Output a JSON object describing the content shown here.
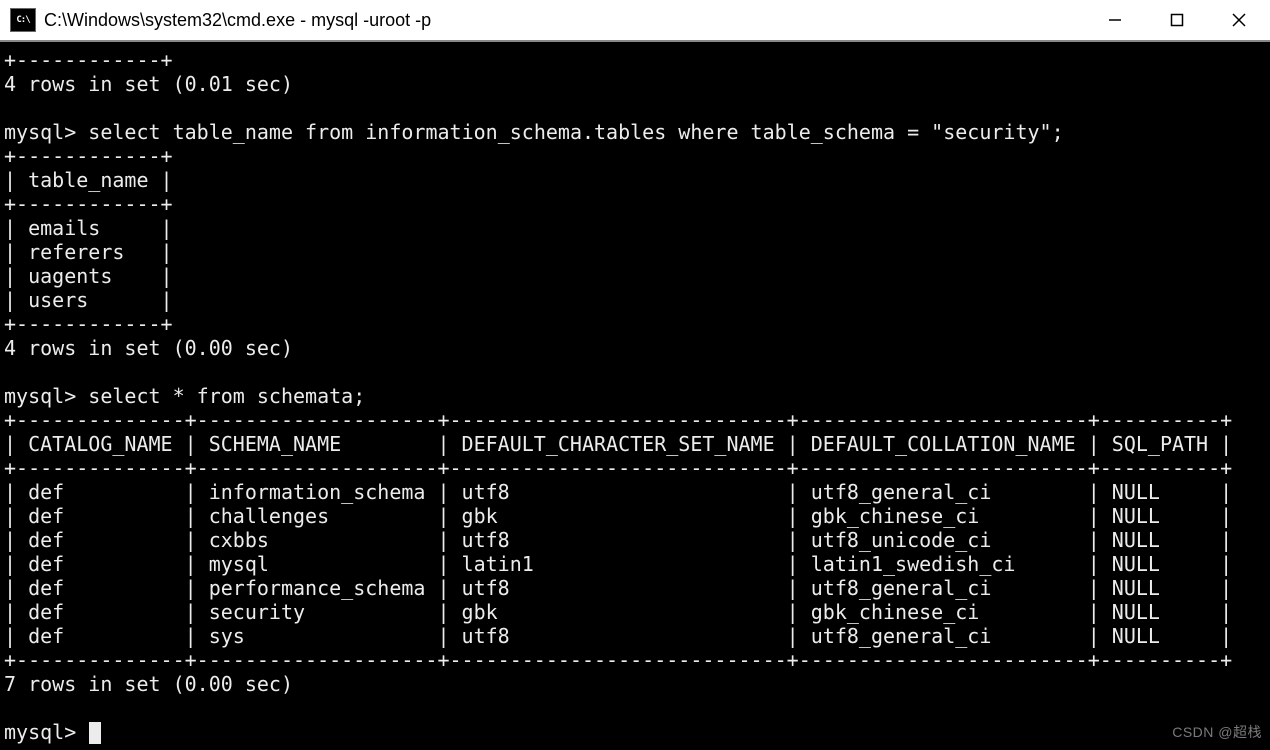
{
  "titlebar": {
    "icon_label": "C:\\",
    "title": "C:\\Windows\\system32\\cmd.exe - mysql  -uroot -p"
  },
  "terminal": {
    "top_border": "+------------+",
    "result1": "4 rows in set (0.01 sec)",
    "prompt": "mysql>",
    "query1": "select table_name from information_schema.tables where table_schema = \"security\";",
    "table1": {
      "border": "+------------+",
      "header_line": "| table_name |",
      "rows": [
        "| emails     |",
        "| referers   |",
        "| uagents    |",
        "| users      |"
      ]
    },
    "result2": "4 rows in set (0.00 sec)",
    "query2": "select * from schemata;",
    "table2": {
      "border": "+--------------+--------------------+----------------------------+------------------------+----------+",
      "header_line": "| CATALOG_NAME | SCHEMA_NAME        | DEFAULT_CHARACTER_SET_NAME | DEFAULT_COLLATION_NAME | SQL_PATH |",
      "rows": [
        "| def          | information_schema | utf8                       | utf8_general_ci        | NULL     |",
        "| def          | challenges         | gbk                        | gbk_chinese_ci         | NULL     |",
        "| def          | cxbbs              | utf8                       | utf8_unicode_ci        | NULL     |",
        "| def          | mysql              | latin1                     | latin1_swedish_ci      | NULL     |",
        "| def          | performance_schema | utf8                       | utf8_general_ci        | NULL     |",
        "| def          | security           | gbk                        | gbk_chinese_ci         | NULL     |",
        "| def          | sys                | utf8                       | utf8_general_ci        | NULL     |"
      ]
    },
    "result3": "7 rows in set (0.00 sec)"
  },
  "watermark": "CSDN @超栈",
  "chart_data": {
    "type": "table",
    "tables": [
      {
        "title": "information_schema.tables where table_schema='security'",
        "columns": [
          "table_name"
        ],
        "rows": [
          [
            "emails"
          ],
          [
            "referers"
          ],
          [
            "uagents"
          ],
          [
            "users"
          ]
        ]
      },
      {
        "title": "schemata",
        "columns": [
          "CATALOG_NAME",
          "SCHEMA_NAME",
          "DEFAULT_CHARACTER_SET_NAME",
          "DEFAULT_COLLATION_NAME",
          "SQL_PATH"
        ],
        "rows": [
          [
            "def",
            "information_schema",
            "utf8",
            "utf8_general_ci",
            "NULL"
          ],
          [
            "def",
            "challenges",
            "gbk",
            "gbk_chinese_ci",
            "NULL"
          ],
          [
            "def",
            "cxbbs",
            "utf8",
            "utf8_unicode_ci",
            "NULL"
          ],
          [
            "def",
            "mysql",
            "latin1",
            "latin1_swedish_ci",
            "NULL"
          ],
          [
            "def",
            "performance_schema",
            "utf8",
            "utf8_general_ci",
            "NULL"
          ],
          [
            "def",
            "security",
            "gbk",
            "gbk_chinese_ci",
            "NULL"
          ],
          [
            "def",
            "sys",
            "utf8",
            "utf8_general_ci",
            "NULL"
          ]
        ]
      }
    ]
  }
}
